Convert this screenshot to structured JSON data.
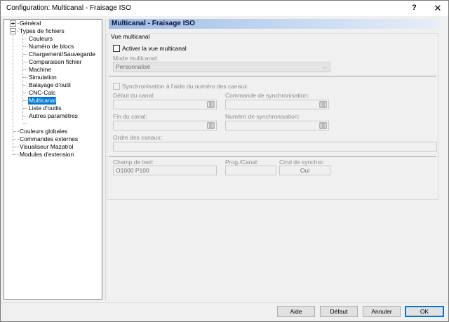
{
  "window": {
    "title": "Configuration: Multicanal - Fraisage ISO",
    "help_glyph": "?",
    "close_glyph": "✕"
  },
  "tree": {
    "items": [
      {
        "label": "Général",
        "level": 0,
        "expander": "plus"
      },
      {
        "label": "Types de fichiers",
        "level": 0,
        "expander": "minus"
      },
      {
        "label": "Couleurs",
        "level": 1
      },
      {
        "label": "Numéro de blocs",
        "level": 1
      },
      {
        "label": "Chargement/Sauvegarde",
        "level": 1
      },
      {
        "label": "Comparaison fichier",
        "level": 1
      },
      {
        "label": "Machine",
        "level": 1
      },
      {
        "label": "Simulation",
        "level": 1
      },
      {
        "label": "Balayage d'outil",
        "level": 1
      },
      {
        "label": "CNC-Calc",
        "level": 1
      },
      {
        "label": "Multicanal",
        "level": 1,
        "selected": true
      },
      {
        "label": "Liste d'outils",
        "level": 1
      },
      {
        "label": "Autres paramètres",
        "level": 1
      },
      {
        "label": "Couleurs globales",
        "level": 0
      },
      {
        "label": "Commandes externes",
        "level": 0
      },
      {
        "label": "Visualiseur Mazatrol",
        "level": 0
      },
      {
        "label": "Modules d'extension",
        "level": 0
      }
    ]
  },
  "panel": {
    "header": "Multicanal - Fraisage ISO",
    "group_title": "Vue multicanal",
    "activate_label": "Activer la vue multicanal",
    "mode_label": "Mode multicanal:",
    "mode_value": "Personnalisé",
    "sync_label": "Synchronisation à l'aide du numéro des canaux",
    "channel_start_label": "Début du canal:",
    "sync_command_label": "Commande de synchronisation:",
    "channel_end_label": "Fin du canal:",
    "sync_number_label": "Numéro de synchronisation:",
    "channel_order_label": "Ordre des canaux:",
    "test_field_label": "Champ de test:",
    "test_field_value": "O1000 P100",
    "prog_channel_label": "Prog./Canal:",
    "sync_cmd_label": "Cmd de synchro:",
    "sync_cmd_value": "Oui"
  },
  "buttons": {
    "help": "Aide",
    "default": "Défaut",
    "cancel": "Annuler",
    "ok": "OK"
  },
  "colors": {
    "selection": "#0078d7",
    "header_gradient_start": "#9cbde6",
    "header_gradient_end": "#e6eef9"
  }
}
